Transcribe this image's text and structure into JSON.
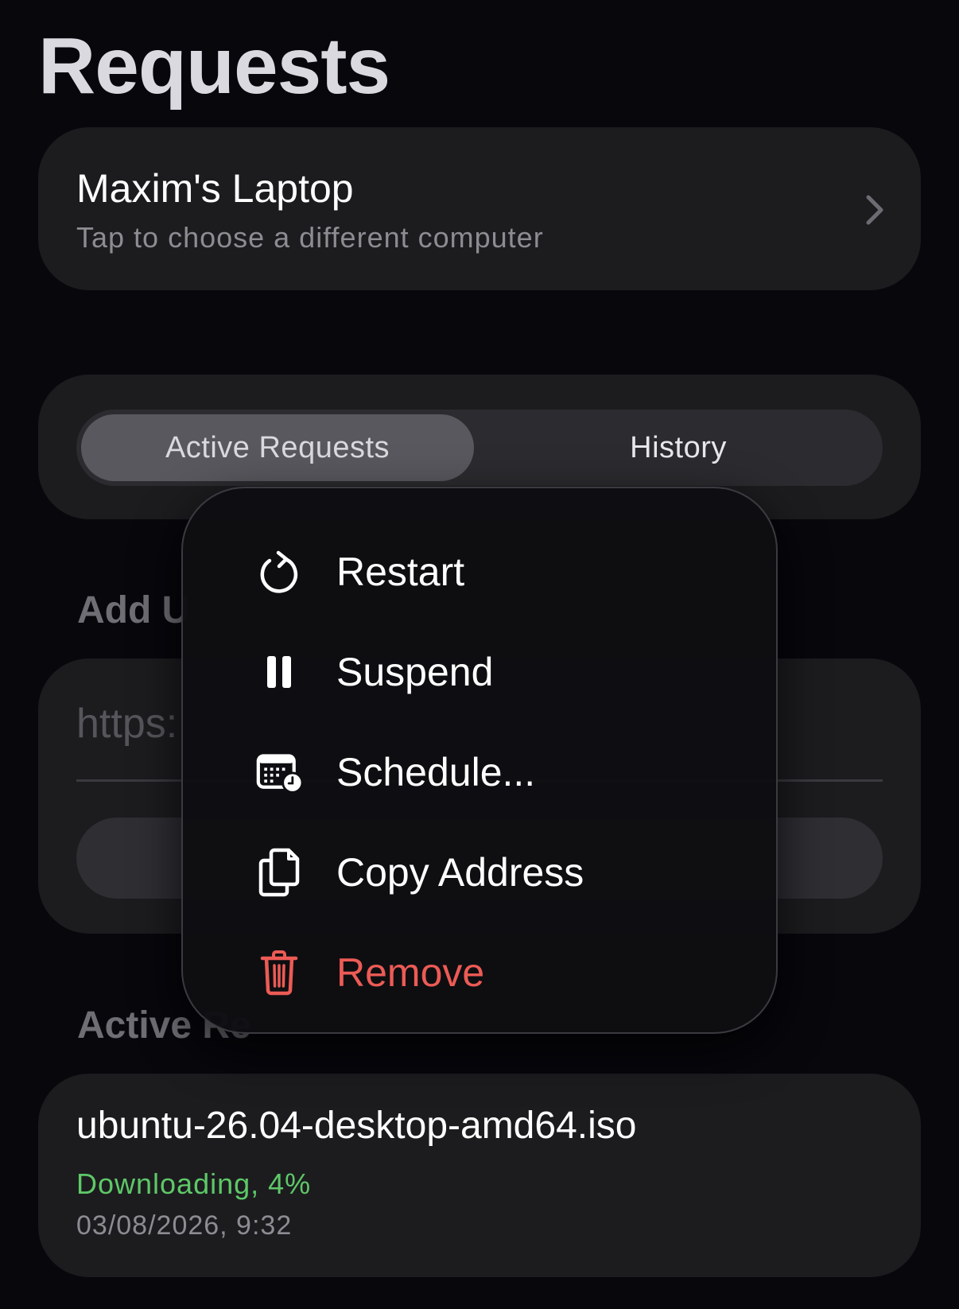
{
  "page": {
    "title": "Requests"
  },
  "computer": {
    "name": "Maxim's Laptop",
    "hint": "Tap to choose a different computer"
  },
  "tabs": [
    {
      "label": "Active Requests",
      "selected": true
    },
    {
      "label": "History",
      "selected": false
    }
  ],
  "add_section": {
    "label_visible": "Add U",
    "url_placeholder": "https:"
  },
  "active_section": {
    "label_visible": "Active Re"
  },
  "requests": [
    {
      "file_name": "ubuntu-26.04-desktop-amd64.iso",
      "status": "Downloading, 4%",
      "timestamp": "03/08/2026, 9:32"
    }
  ],
  "context_menu": {
    "items": [
      {
        "label": "Restart",
        "icon": "restart-icon"
      },
      {
        "label": "Suspend",
        "icon": "pause-icon"
      },
      {
        "label": "Schedule...",
        "icon": "calendar-clock-icon"
      },
      {
        "label": "Copy Address",
        "icon": "copy-icon"
      },
      {
        "label": "Remove",
        "icon": "trash-icon",
        "destructive": true
      }
    ]
  },
  "colors": {
    "background": "#07070c",
    "card": "#1c1c1f",
    "status_green": "#5ec867",
    "destructive_red": "#ec5b55",
    "secondary_text": "#8c8c92"
  }
}
